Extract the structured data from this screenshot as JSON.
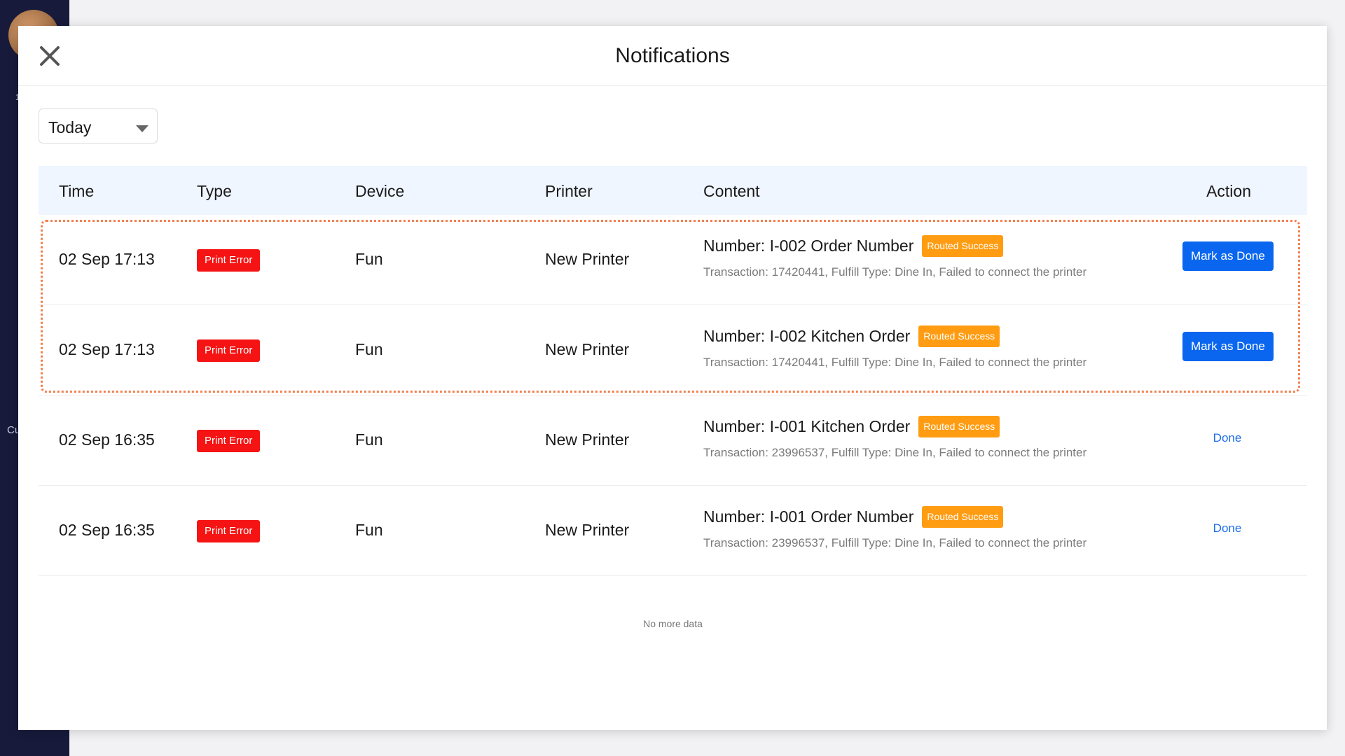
{
  "background": {
    "sidebar_text": "Cu",
    "sidebar_dot": "1"
  },
  "modal": {
    "title": "Notifications"
  },
  "filter": {
    "selected": "Today"
  },
  "table": {
    "headers": {
      "time": "Time",
      "type": "Type",
      "device": "Device",
      "printer": "Printer",
      "content": "Content",
      "action": "Action"
    },
    "rows": [
      {
        "time": "02 Sep 17:13",
        "type": "Print Error",
        "device": "Fun",
        "printer": "New Printer",
        "content_title": "Number: I-002 Order Number",
        "status": "Routed Success",
        "content_detail": "Transaction: 17420441, Fulfill Type: Dine In, Failed to connect the printer",
        "action": "Mark as Done"
      },
      {
        "time": "02 Sep 17:13",
        "type": "Print Error",
        "device": "Fun",
        "printer": "New Printer",
        "content_title": "Number: I-002 Kitchen Order",
        "status": "Routed Success",
        "content_detail": "Transaction: 17420441, Fulfill Type: Dine In, Failed to connect the printer",
        "action": "Mark as Done"
      },
      {
        "time": "02 Sep 16:35",
        "type": "Print Error",
        "device": "Fun",
        "printer": "New Printer",
        "content_title": "Number: I-001 Kitchen Order",
        "status": "Routed Success",
        "content_detail": "Transaction: 23996537, Fulfill Type: Dine In, Failed to connect the printer",
        "action": "Done"
      },
      {
        "time": "02 Sep 16:35",
        "type": "Print Error",
        "device": "Fun",
        "printer": "New Printer",
        "content_title": "Number: I-001 Order Number",
        "status": "Routed Success",
        "content_detail": "Transaction: 23996537, Fulfill Type: Dine In, Failed to connect the printer",
        "action": "Done"
      }
    ],
    "footer": "No more data"
  },
  "colors": {
    "error_badge": "#f51313",
    "status_badge": "#ff9c12",
    "primary_button": "#0a66ef",
    "link": "#1e6ee8",
    "header_bg": "#f0f6ff",
    "highlight_border": "#f27f4e"
  },
  "icons": {
    "close": "close-icon",
    "dropdown": "caret-down-icon"
  }
}
